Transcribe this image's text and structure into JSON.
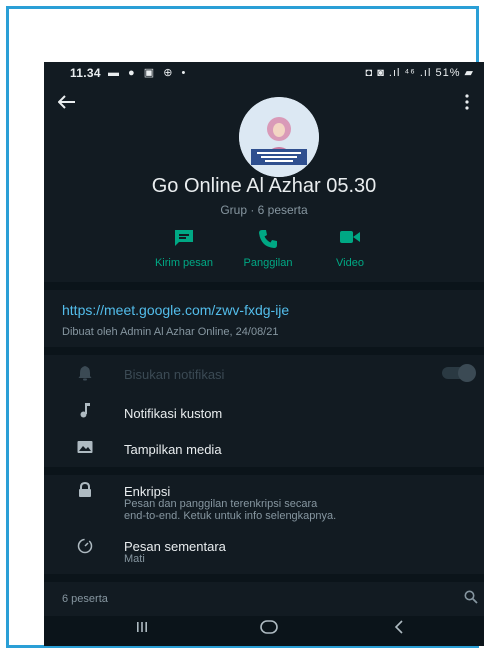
{
  "status_bar": {
    "time": "11.34",
    "left_icons": "▬ ● ▣ ⊕ •",
    "right_icons": "◘ ◙ .ıl ⁴⁶ .ıl 51% ▰"
  },
  "header": {
    "back_icon": "arrow-left-icon",
    "more_icon": "more-vert-icon"
  },
  "group": {
    "name": "Go Online Al Azhar 05.30",
    "subtitle": "Grup · 6 peserta"
  },
  "actions": [
    {
      "label": "Kirim pesan",
      "icon": "message-icon"
    },
    {
      "label": "Panggilan",
      "icon": "phone-icon"
    },
    {
      "label": "Video",
      "icon": "video-icon"
    }
  ],
  "description": {
    "link": "https://meet.google.com/zwv-fxdg-ije",
    "meta": "Dibuat oleh Admin Al Azhar Online, 24/08/21"
  },
  "settings": {
    "mute": "Bisukan notifikasi",
    "custom_notif": "Notifikasi kustom",
    "media": "Tampilkan media"
  },
  "security": {
    "encryption_title": "Enkripsi",
    "encryption_desc_1": "Pesan dan panggilan terenkripsi secara",
    "encryption_desc_2": "end-to-end. Ketuk untuk info selengkapnya.",
    "disappearing_title": "Pesan sementara",
    "disappearing_value": "Mati"
  },
  "participants": {
    "count_label": "6 peserta"
  },
  "colors": {
    "accent": "#00a884",
    "link": "#53bdeb",
    "background": "#121b22",
    "frame": "#2a9fd6"
  }
}
